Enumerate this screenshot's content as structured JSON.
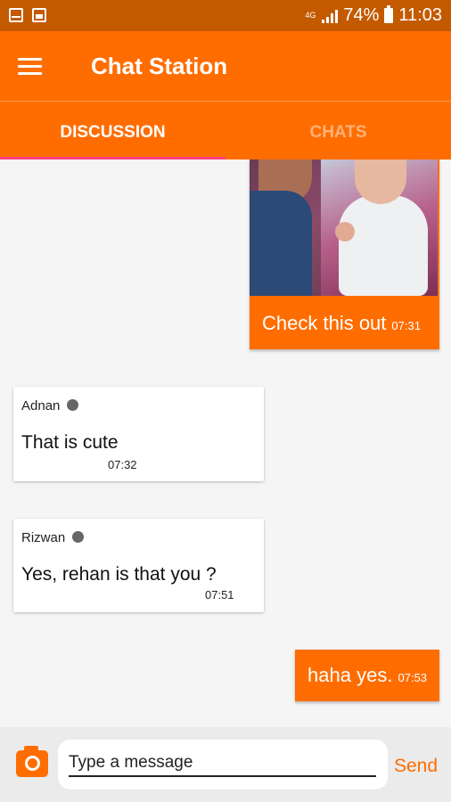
{
  "status_bar": {
    "network": "4G",
    "battery": "74%",
    "time": "11:03"
  },
  "app_bar": {
    "title": "Chat Station"
  },
  "tabs": [
    {
      "label": "DISCUSSION",
      "active": true
    },
    {
      "label": "CHATS",
      "active": false
    }
  ],
  "messages": [
    {
      "type": "outgoing-image",
      "text": "Check this out",
      "time": "07:31"
    },
    {
      "type": "incoming",
      "sender": "Adnan",
      "text": "That is cute",
      "time": "07:32"
    },
    {
      "type": "incoming",
      "sender": "Rizwan",
      "text": "Yes, rehan is that you ?",
      "time": "07:51"
    },
    {
      "type": "outgoing",
      "text": "haha yes.",
      "time": "07:53"
    }
  ],
  "composer": {
    "placeholder": "Type a message",
    "send_label": "Send"
  },
  "colors": {
    "primary": "#ff6d00",
    "status_bar": "#c35a00",
    "tab_indicator": "#ff4081",
    "background": "#f5f5f5"
  }
}
